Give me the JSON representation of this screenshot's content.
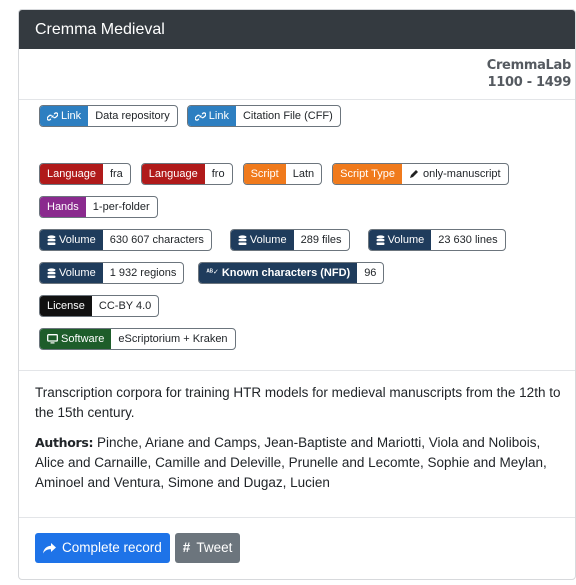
{
  "header": {
    "title": "Cremma Medieval"
  },
  "meta": {
    "lab": "CremmaLab",
    "period": "1100 - 1499"
  },
  "colors": {
    "link": "#2d7fc1",
    "language": "#b01a1a",
    "script": "#f07a1c",
    "hands": "#8a2a8e",
    "volume": "#1f3c5c",
    "license": "#111111",
    "software": "#1e5d2a"
  },
  "badges": {
    "link1": {
      "key": "Link",
      "value": "Data repository",
      "icon": "link-icon"
    },
    "link2": {
      "key": "Link",
      "value": "Citation File (CFF)",
      "icon": "link-icon"
    },
    "lang1": {
      "key": "Language",
      "value": "fra"
    },
    "lang2": {
      "key": "Language",
      "value": "fro"
    },
    "script": {
      "key": "Script",
      "value": "Latn"
    },
    "scripttype": {
      "key": "Script Type",
      "value": "only-manuscript",
      "icon": "pen-icon"
    },
    "hands": {
      "key": "Hands",
      "value": "1-per-folder"
    },
    "vol1": {
      "key": "Volume",
      "value": "630 607 characters",
      "icon": "database-icon"
    },
    "vol2": {
      "key": "Volume",
      "value": "289 files",
      "icon": "database-icon"
    },
    "vol3": {
      "key": "Volume",
      "value": "23 630 lines",
      "icon": "database-icon"
    },
    "vol4": {
      "key": "Volume",
      "value": "1 932 regions",
      "icon": "database-icon"
    },
    "known": {
      "key": "Known characters (NFD)",
      "value": "96",
      "icon": "spell-check-icon"
    },
    "license": {
      "key": "License",
      "value": "CC-BY 4.0"
    },
    "software": {
      "key": "Software",
      "value": "eScriptorium + Kraken",
      "icon": "desktop-icon"
    }
  },
  "description": {
    "text": "Transcription corpora for training HTR models for medieval manuscripts from the 12th to the 15th century.",
    "authors_label": "Authors:",
    "authors": "Pinche, Ariane and Camps, Jean-Baptiste and Mariotti, Viola and Nolibois, Alice and Carnaille, Camille and Deleville, Prunelle and Lecomte, Sophie and Meylan, Aminoel and Ventura, Simone and Dugaz, Lucien"
  },
  "footer": {
    "complete_record": "Complete record",
    "tweet": "Tweet"
  }
}
